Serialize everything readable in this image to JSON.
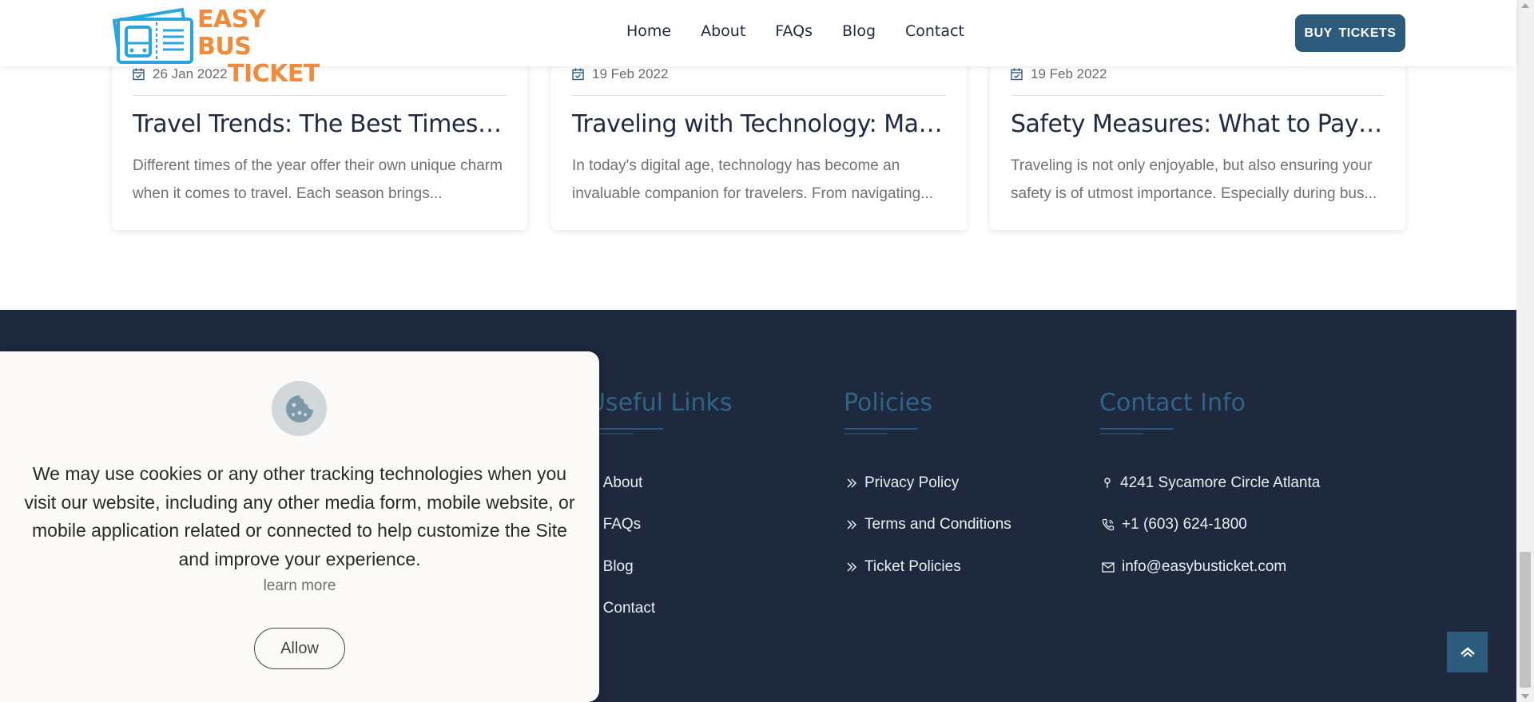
{
  "header": {
    "logo_text_line1": "EASY BUS",
    "logo_text_line2": "TICKET",
    "nav": [
      "Home",
      "About",
      "FAQs",
      "Blog",
      "Contact"
    ],
    "buy_tickets": "BUY TICKETS"
  },
  "cards": [
    {
      "date": "26 Jan 2022",
      "title": "Travel Trends: The Best Times to Travel",
      "excerpt": "Different times of the year offer their own unique charm when it comes to travel. Each season brings..."
    },
    {
      "date": "19 Feb 2022",
      "title": "Traveling with Technology: Making the Most of It",
      "excerpt": "In today's digital age, technology has become an invaluable companion for travelers. From navigating..."
    },
    {
      "date": "19 Feb 2022",
      "title": "Safety Measures: What to Pay Attention To",
      "excerpt": "Traveling is not only enjoyable, but also ensuring your safety is of utmost importance. Especially during bus..."
    }
  ],
  "footer": {
    "useful_links": {
      "title": "Useful Links",
      "items": [
        "About",
        "FAQs",
        "Blog",
        "Contact"
      ]
    },
    "policies": {
      "title": "Policies",
      "items": [
        "Privacy Policy",
        "Terms and Conditions",
        "Ticket Policies"
      ]
    },
    "contact": {
      "title": "Contact Info",
      "address": "4241 Sycamore Circle Atlanta",
      "phone": "+1 (603) 624-1800",
      "email": "info@easybusticket.com"
    }
  },
  "cookie": {
    "text": "We may use cookies or any other tracking technologies when you visit our website, including any other media form, mobile website, or mobile application related or connected to help customize the Site and improve your experience.",
    "learn_more": "learn more",
    "allow": "Allow"
  },
  "colors": {
    "accent": "#2d5b7e",
    "logo_orange": "#ef8b3c",
    "logo_blue": "#2aa6df",
    "footer_bg": "#1e293d",
    "footer_heading": "#2f6487"
  }
}
